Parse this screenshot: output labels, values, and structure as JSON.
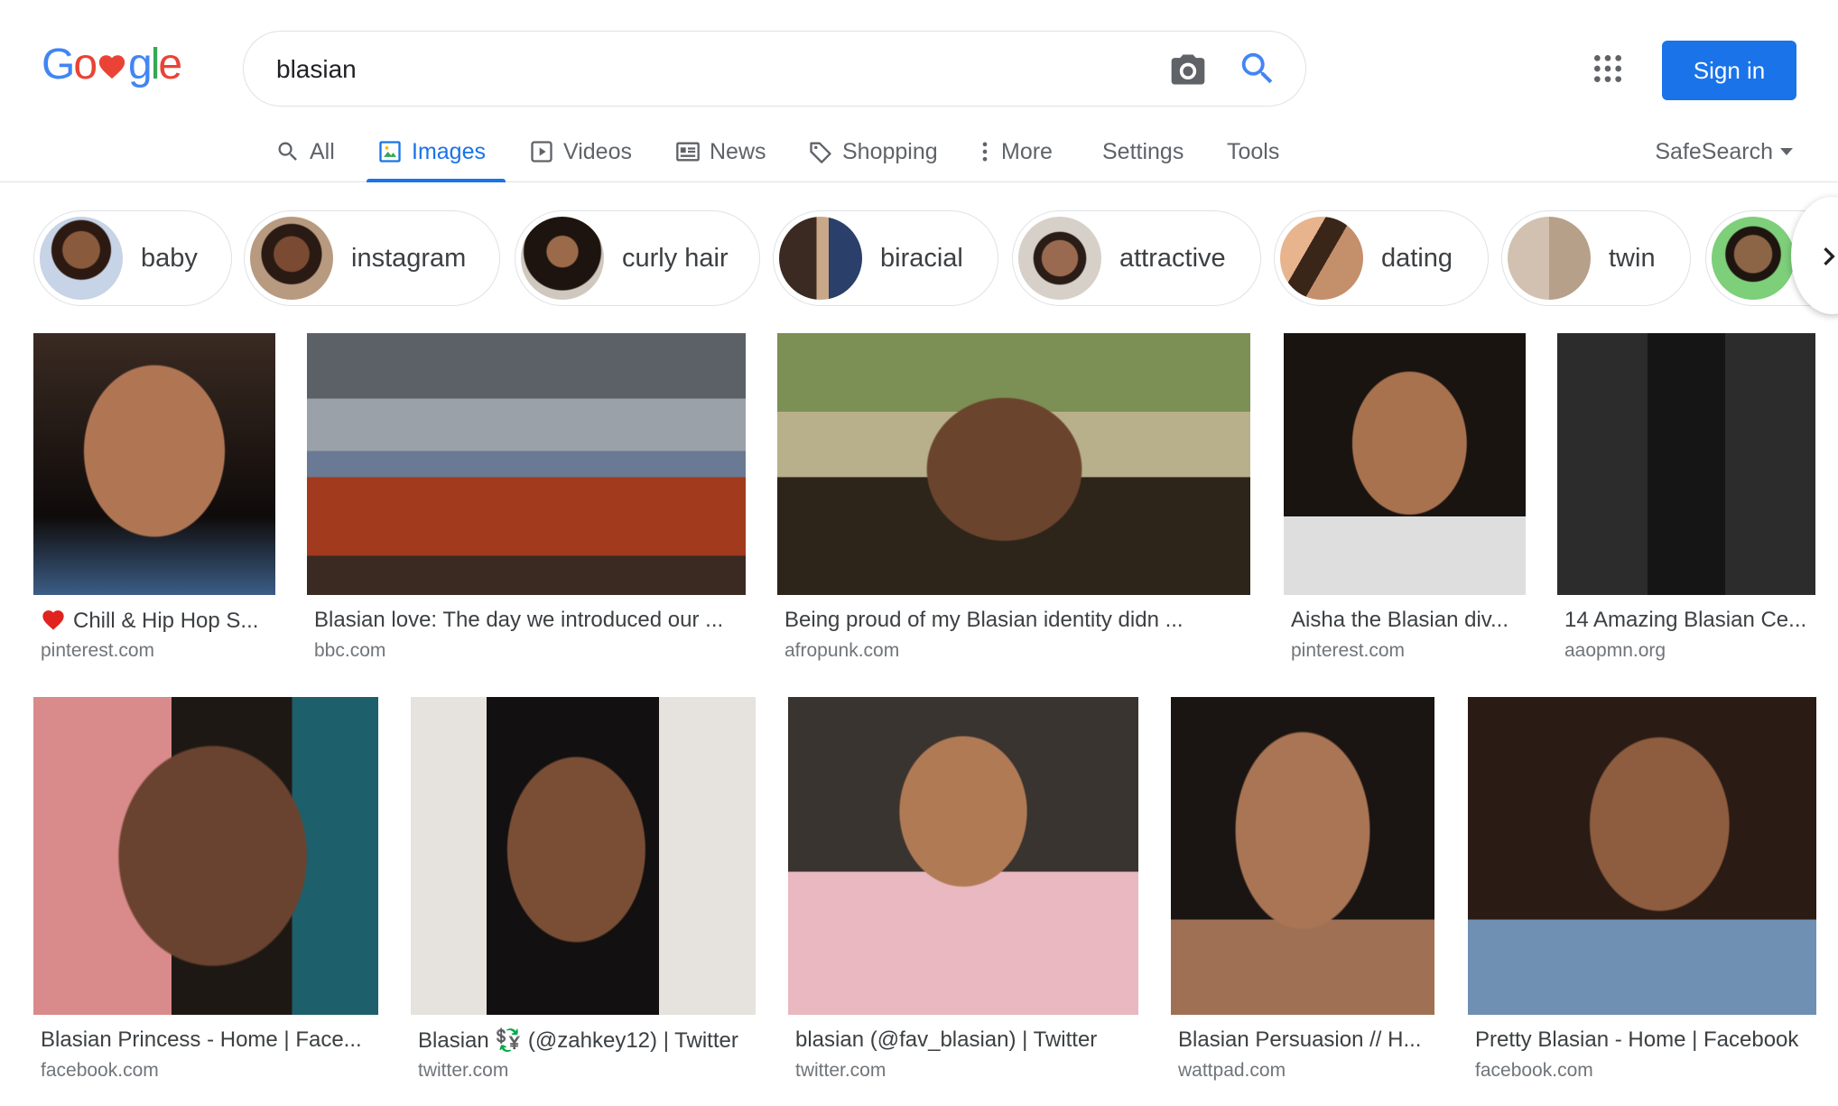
{
  "search": {
    "query": "blasian"
  },
  "header": {
    "sign_in": "Sign in"
  },
  "tabs": [
    {
      "label": "All",
      "icon": "search-icon"
    },
    {
      "label": "Images",
      "icon": "image-icon"
    },
    {
      "label": "Videos",
      "icon": "video-icon"
    },
    {
      "label": "News",
      "icon": "news-icon"
    },
    {
      "label": "Shopping",
      "icon": "tag-icon"
    },
    {
      "label": "More",
      "icon": "more-vert-icon"
    },
    {
      "label": "Settings"
    },
    {
      "label": "Tools"
    }
  ],
  "safesearch": "SafeSearch",
  "chips": [
    {
      "label": "baby"
    },
    {
      "label": "instagram"
    },
    {
      "label": "curly hair"
    },
    {
      "label": "biracial"
    },
    {
      "label": "attractive"
    },
    {
      "label": "dating"
    },
    {
      "label": "twin"
    },
    {
      "label": ""
    }
  ],
  "results": [
    {
      "title": "Chill & Hip Hop S...",
      "domain": "pinterest.com",
      "title_icon": "heart-icon"
    },
    {
      "title": "Blasian love: The day we introduced our ...",
      "domain": "bbc.com"
    },
    {
      "title": "Being proud of my Blasian identity didn ...",
      "domain": "afropunk.com"
    },
    {
      "title": "Aisha the Blasian div...",
      "domain": "pinterest.com"
    },
    {
      "title": "14 Amazing Blasian Ce...",
      "domain": "aaopmn.org"
    },
    {
      "title": "Blasian Princess - Home | Face...",
      "domain": "facebook.com"
    },
    {
      "title": "Blasian 💱 (@zahkey12) | Twitter",
      "domain": "twitter.com"
    },
    {
      "title": "blasian (@fav_blasian) | Twitter",
      "domain": "twitter.com"
    },
    {
      "title": "Blasian Persuasion // H...",
      "domain": "wattpad.com"
    },
    {
      "title": "Pretty Blasian - Home | Facebook",
      "domain": "facebook.com"
    }
  ],
  "colors": {
    "accent": "#1a73e8",
    "text_secondary": "#5f6368",
    "domain": "#70757a",
    "border": "#dfe1e5"
  }
}
